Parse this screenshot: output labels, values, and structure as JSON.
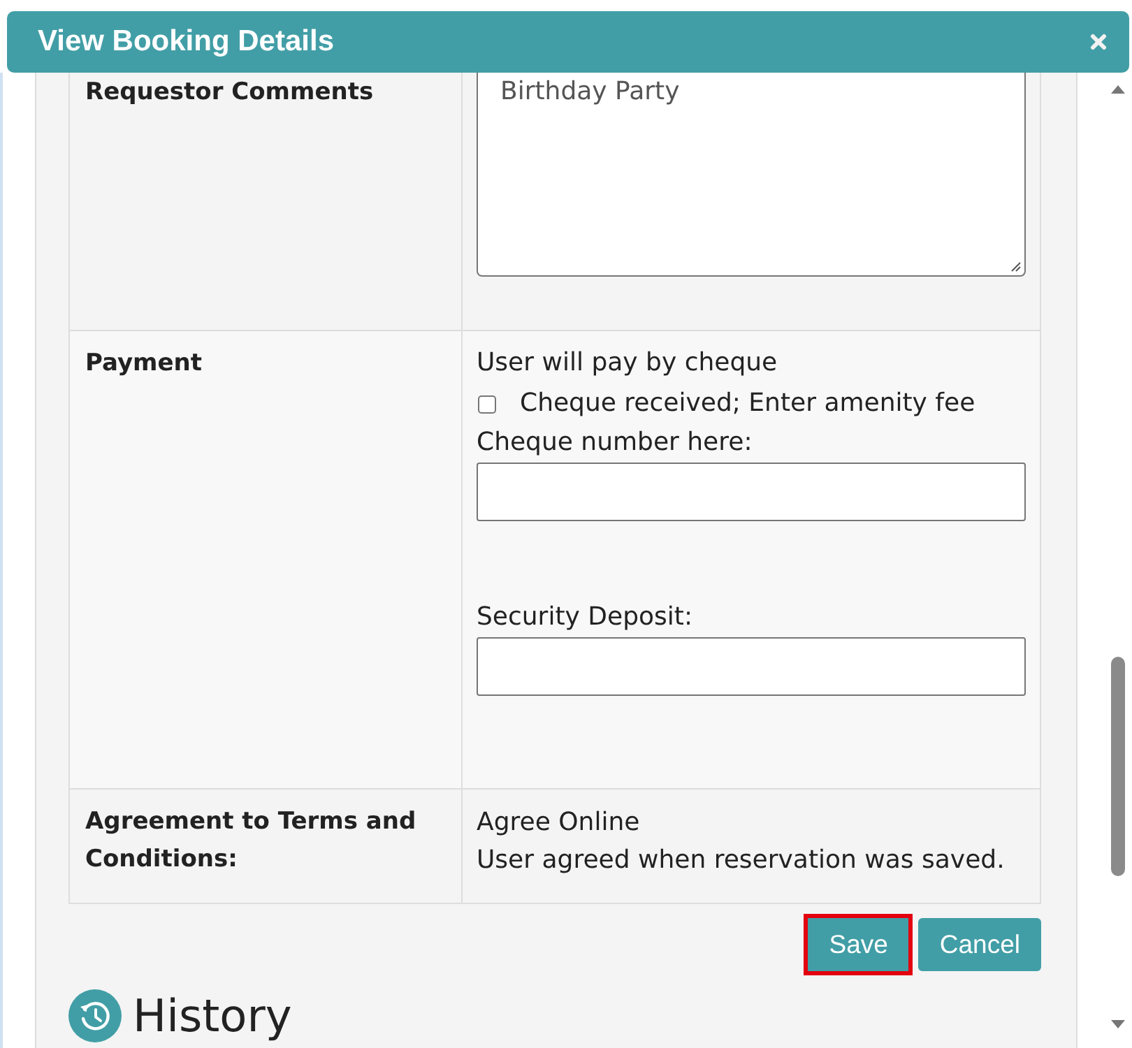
{
  "dialog": {
    "title": "View Booking Details"
  },
  "rows": [
    {
      "kind": "textarea",
      "label": "Requestor Comments",
      "value": "Birthday Party"
    },
    {
      "kind": "payment",
      "label": "Payment",
      "note": "User will pay by cheque",
      "checkbox": {
        "label": "Cheque received; Enter amenity fee",
        "checked": false
      },
      "fields": [
        {
          "label": "Cheque number here:"
        },
        {
          "label": "Security Deposit:"
        }
      ]
    },
    {
      "kind": "text",
      "label": "Agreement to Terms and Conditions:",
      "lines": [
        "Agree Online",
        "User agreed when reservation was saved."
      ]
    }
  ],
  "buttons": [
    {
      "label": "Save",
      "highlighted": true
    },
    {
      "label": "Cancel",
      "highlighted": false
    }
  ],
  "history": {
    "title": "History"
  }
}
